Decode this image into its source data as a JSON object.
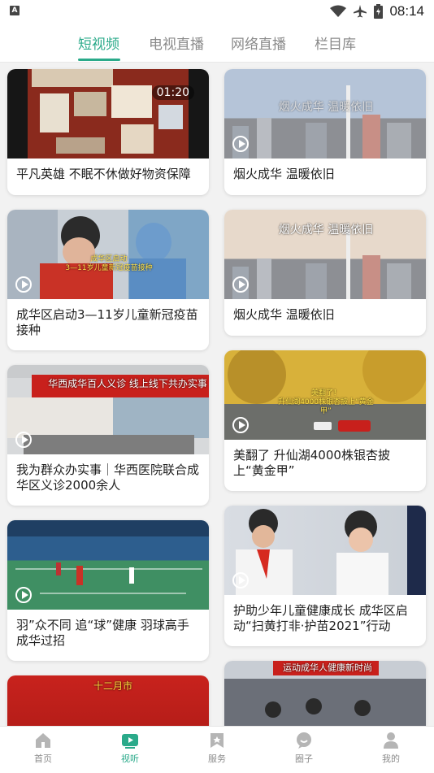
{
  "status_bar": {
    "time": "08:14",
    "left_icon": "A"
  },
  "tabs": [
    {
      "label": "短视频",
      "active": true
    },
    {
      "label": "电视直播",
      "active": false
    },
    {
      "label": "网络直播",
      "active": false
    },
    {
      "label": "栏目库",
      "active": false
    }
  ],
  "feed": {
    "left": [
      {
        "title": "平凡英雄 不眠不休做好物资保障",
        "duration": "01:20"
      },
      {
        "title": "成华区启动3—11岁儿童新冠疫苗接种",
        "overlay": "成华区启动\n3—11岁儿童新冠疫苗接种"
      },
      {
        "title": "我为群众办实事｜华西医院联合成华区义诊2000余人",
        "overlay": "华西成华百人义诊 线上线下共办实事"
      },
      {
        "title": "羽”众不同 追“球”健康 羽球高手成华过招"
      },
      {
        "title": "",
        "overlay": "十二月市"
      }
    ],
    "right": [
      {
        "title": "烟火成华 温暖依旧",
        "overlay": "烟火成华 温暖依旧"
      },
      {
        "title": "烟火成华 温暖依旧",
        "overlay": "烟火成华 温暖依旧"
      },
      {
        "title": "美翻了 升仙湖4000株银杏披上“黄金甲”",
        "overlay": "美翻了！\n升仙湖4000株银杏披上“黄金甲”"
      },
      {
        "title": "护助少年儿童健康成长 成华区启动“扫黄打非·护苗2021”行动"
      },
      {
        "title": "",
        "overlay": "运动成华人健康新时尚"
      }
    ]
  },
  "bottom_nav": [
    {
      "label": "首页",
      "icon": "home-icon",
      "active": false
    },
    {
      "label": "视听",
      "icon": "video-icon",
      "active": true
    },
    {
      "label": "服务",
      "icon": "bookmark-icon",
      "active": false
    },
    {
      "label": "圈子",
      "icon": "chat-bubble-icon",
      "active": false
    },
    {
      "label": "我的",
      "icon": "person-icon",
      "active": false
    }
  ],
  "colors": {
    "accent": "#2aaa8a",
    "inactive": "#8a8a8a"
  }
}
